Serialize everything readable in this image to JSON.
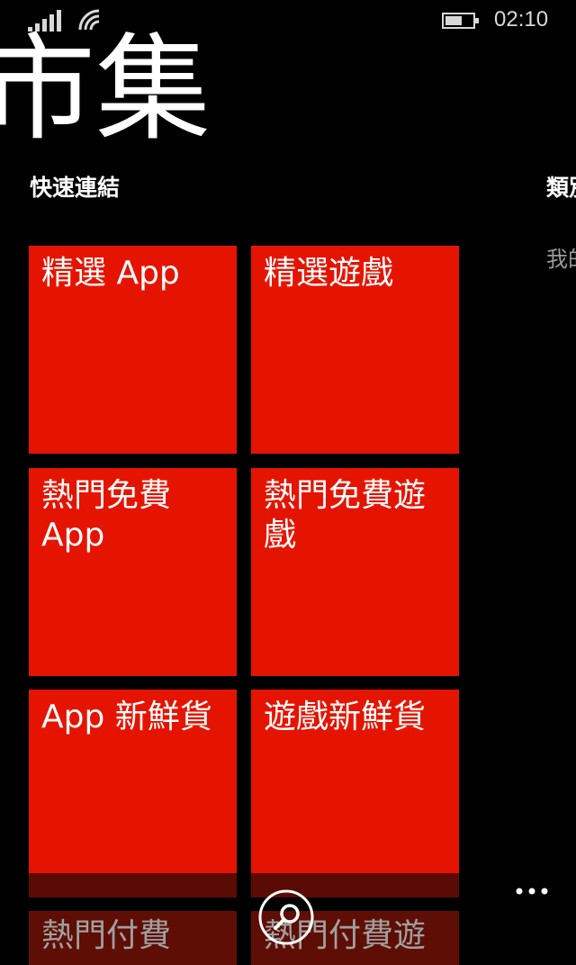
{
  "status_bar": {
    "time": "02:10"
  },
  "header": {
    "title": "市集"
  },
  "sections": {
    "quick_links": "快速連結",
    "categories": "類別"
  },
  "peek": {
    "text": "我的"
  },
  "tiles": [
    {
      "label": "精選 App"
    },
    {
      "label": "精選遊戲"
    },
    {
      "label": "熱門免費 App"
    },
    {
      "label": "熱門免費遊戲"
    },
    {
      "label": "App 新鮮貨"
    },
    {
      "label": "遊戲新鮮貨"
    },
    {
      "label": "熱門付費"
    },
    {
      "label": "熱門付費遊"
    }
  ],
  "app_bar": {
    "search_icon": "search-icon",
    "more_icon": "more-icon"
  },
  "colors": {
    "accent": "#e51400",
    "background": "#000000"
  }
}
